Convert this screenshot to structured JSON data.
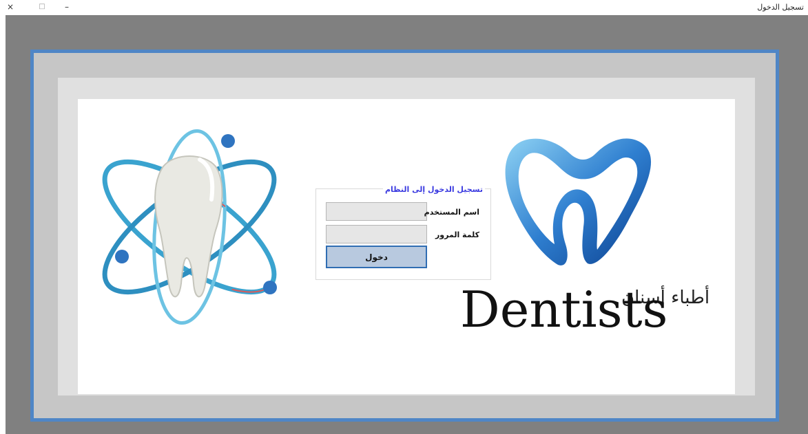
{
  "window": {
    "title": "تسجيل الدخول",
    "close_icon": "×",
    "maximize_icon": "□",
    "minimize_icon": "–"
  },
  "login": {
    "title": "تسجيل الدخول إلى النظام",
    "username_label": "اسم المستخدم",
    "username_value": "",
    "password_label": "كلمة المرور",
    "password_value": "",
    "submit_label": "دخول"
  },
  "brand": {
    "name": "Dentists",
    "arabic_name": "أطباء أسنان"
  },
  "colors": {
    "accent": "#4f86c6",
    "title_blue": "#3a3ae0"
  }
}
